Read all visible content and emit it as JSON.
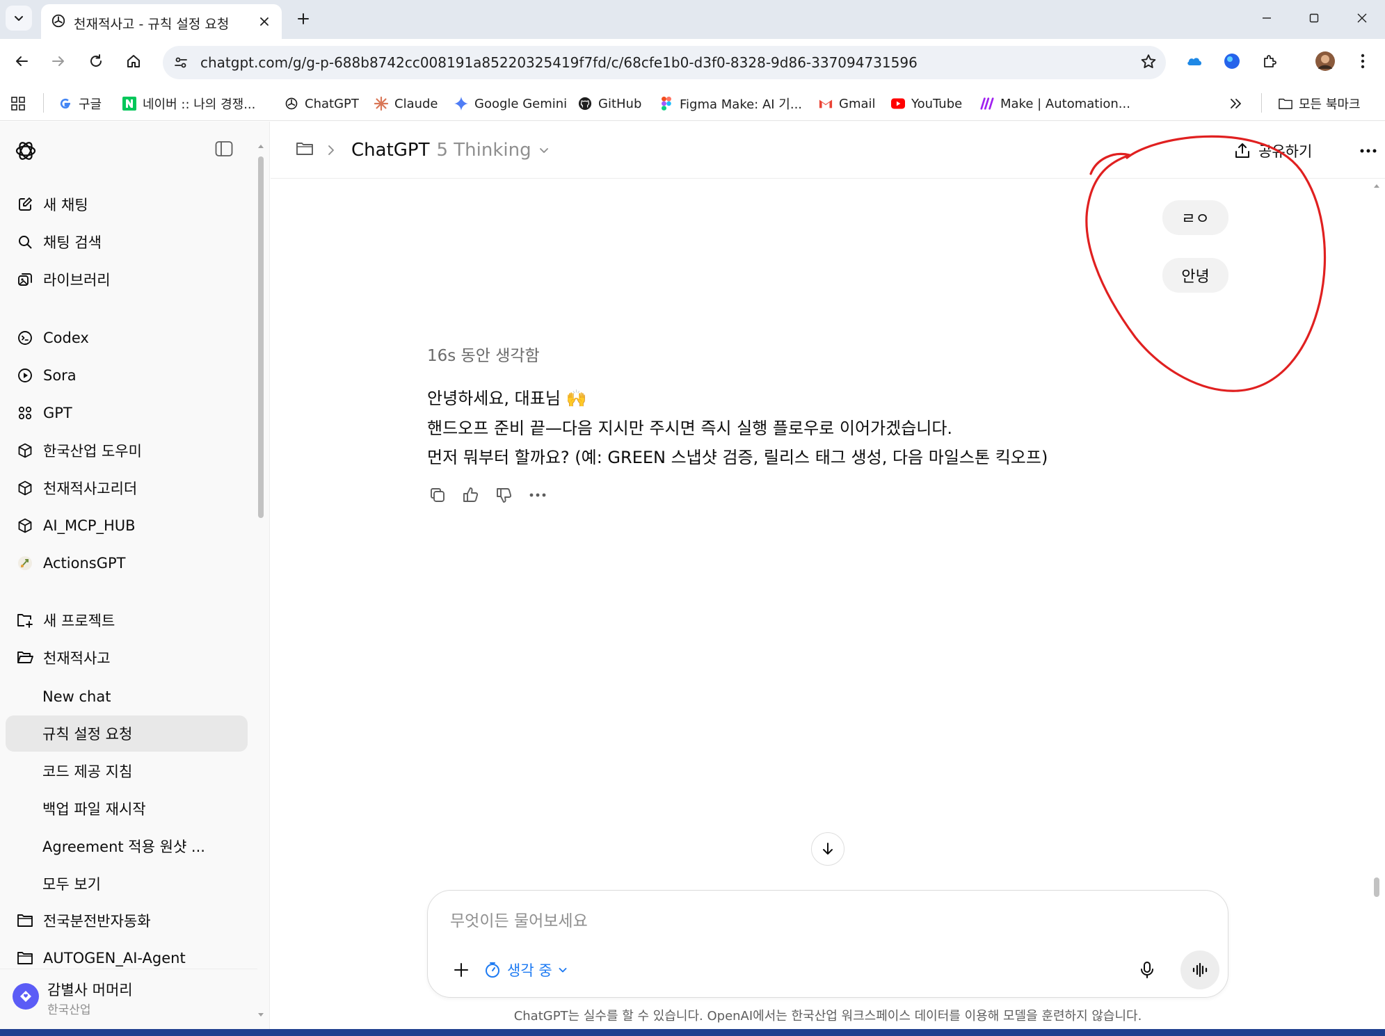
{
  "browser": {
    "tab_title": "천재적사고 - 규칙 설정 요청",
    "url": "chatgpt.com/g/g-p-688b8742cc008191a85220325419f7fd/c/68cfe1b0-d3f0-8328-9d86-337094731596",
    "bookmarks": [
      {
        "label": "구글",
        "icon": "google-icon"
      },
      {
        "label": "네이버 :: 나의 경쟁...",
        "icon": "naver-icon"
      },
      {
        "label": "ChatGPT",
        "icon": "chatgpt-icon"
      },
      {
        "label": "Claude",
        "icon": "claude-icon"
      },
      {
        "label": "Google Gemini",
        "icon": "gemini-icon"
      },
      {
        "label": "GitHub",
        "icon": "github-icon"
      },
      {
        "label": "Figma Make: AI 기...",
        "icon": "figma-icon"
      },
      {
        "label": "Gmail",
        "icon": "gmail-icon"
      },
      {
        "label": "YouTube",
        "icon": "youtube-icon"
      },
      {
        "label": "Make | Automation...",
        "icon": "make-icon"
      }
    ],
    "all_bookmarks_label": "모든 북마크"
  },
  "sidebar": {
    "top_items": [
      {
        "label": "새 채팅",
        "icon": "new-chat-icon"
      },
      {
        "label": "채팅 검색",
        "icon": "search-icon"
      },
      {
        "label": "라이브러리",
        "icon": "library-icon"
      }
    ],
    "gpt_items": [
      {
        "label": "Codex",
        "icon": "codex-icon"
      },
      {
        "label": "Sora",
        "icon": "sora-icon"
      },
      {
        "label": "GPT",
        "icon": "gpt-grid-icon"
      },
      {
        "label": "한국산업 도우미",
        "icon": "cube-icon"
      },
      {
        "label": "천재적사고리더",
        "icon": "cube-icon"
      },
      {
        "label": "AI_MCP_HUB",
        "icon": "cube-icon"
      },
      {
        "label": "ActionsGPT",
        "icon": "actionsgpt-icon"
      }
    ],
    "new_project_label": "새 프로젝트",
    "project": {
      "label": "천재적사고",
      "chats": [
        "New chat",
        "규칙 설정 요청",
        "코드 제공 지침",
        "백업 파일 재시작",
        "Agreement 적용 원샷 ..."
      ],
      "active_chat": "규칙 설정 요청",
      "see_all_label": "모두 보기"
    },
    "other_projects": [
      "전국분전반자동화",
      "AUTOGEN_AI-Agent"
    ],
    "profile": {
      "name": "감별사 머머리",
      "org": "한국산업"
    }
  },
  "header": {
    "model_name": "ChatGPT",
    "model_variant": "5 Thinking",
    "share_label": "공유하기"
  },
  "conversation": {
    "user_messages": [
      "ㄹㅇ",
      "안녕"
    ],
    "thought_label": "16s 동안 생각함",
    "reply_lines": [
      "안녕하세요, 대표님 🙌",
      "핸드오프 준비 끝—다음 지시만 주시면 즉시 실행 플로우로 이어가겠습니다.",
      "먼저 뭐부터 할까요? (예: GREEN 스냅샷 검증, 릴리스 태그 생성, 다음 마일스톤 킥오프)"
    ]
  },
  "composer": {
    "placeholder": "무엇이든 물어보세요",
    "mode_label": "생각 중"
  },
  "disclaimer": "ChatGPT는 실수를 할 수 있습니다. OpenAI에서는 한국산업 워크스페이스 데이터를 이용해 모델을 훈련하지 않습니다.",
  "colors": {
    "accent_blue": "#1d7af2",
    "annotation_red": "#e02020",
    "active_row": "#e8e8e8"
  }
}
